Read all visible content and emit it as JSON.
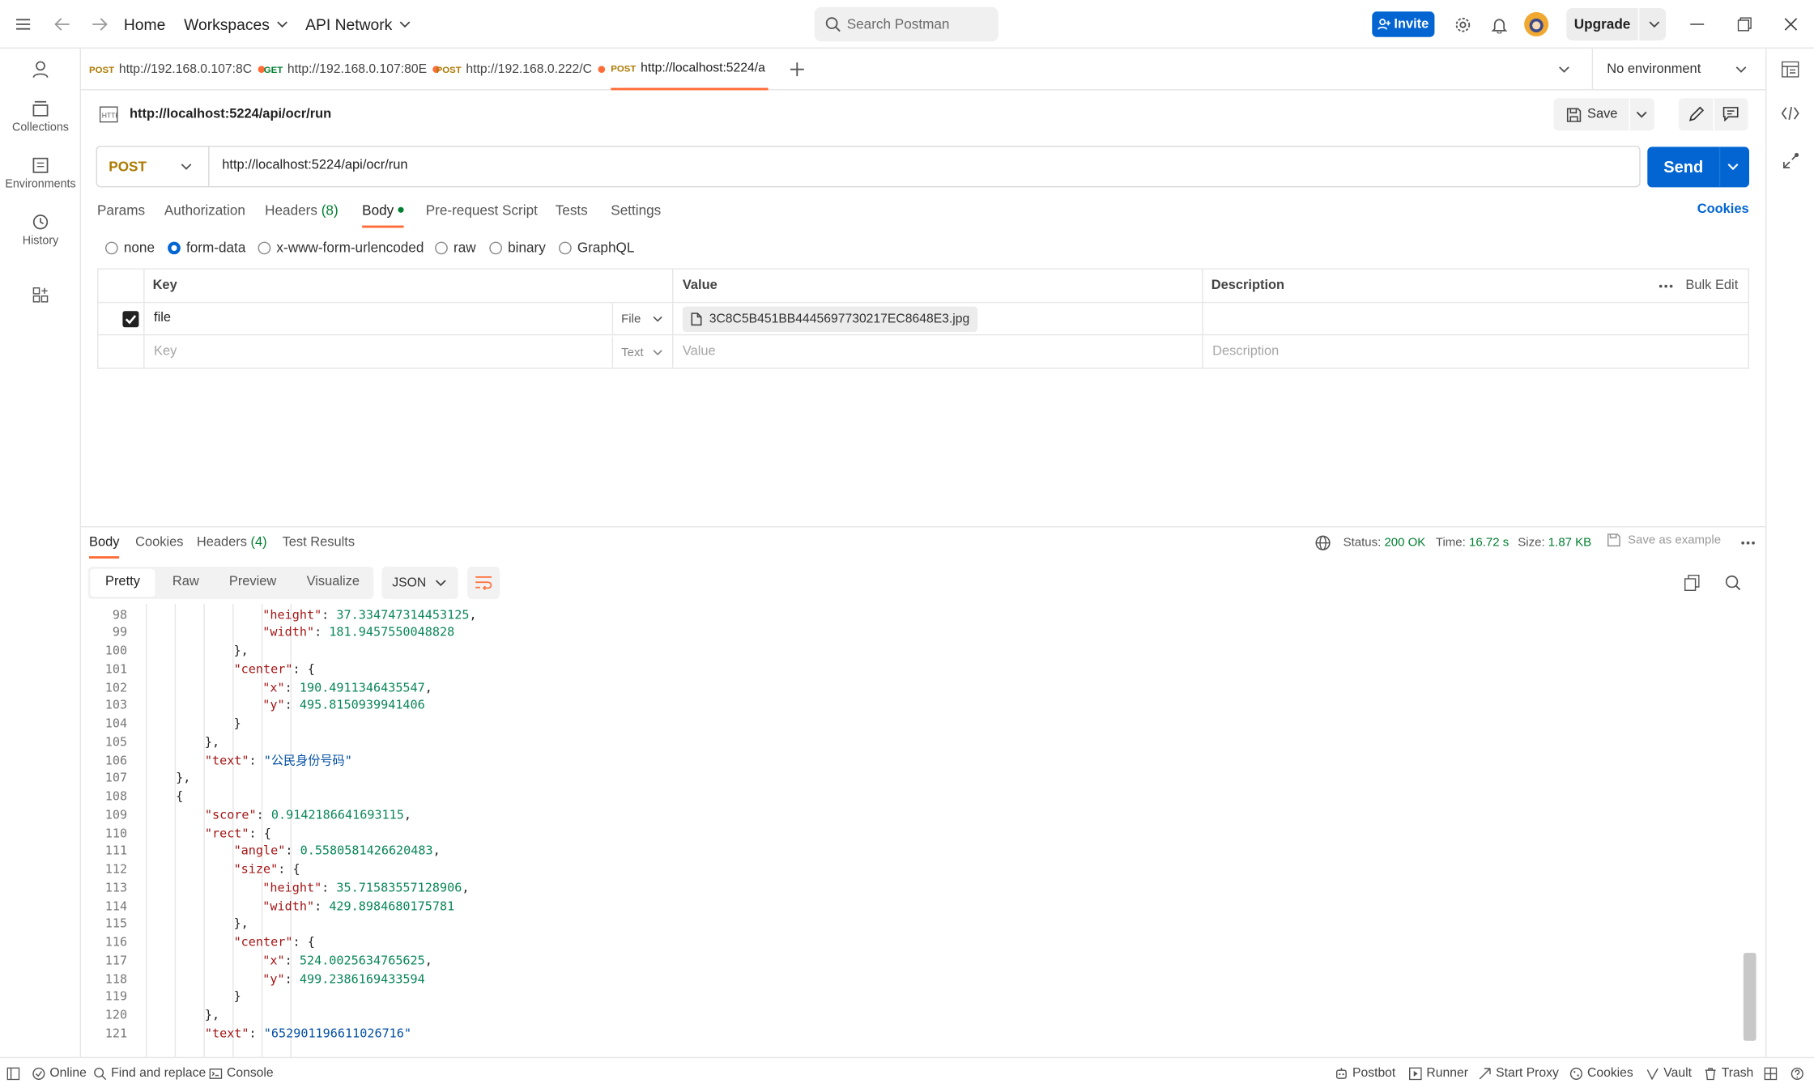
{
  "colors": {
    "accent": "#0265d2",
    "post": "#ad7a03",
    "get": "#007f31",
    "status_ok": "#007f31",
    "dot": "#ff6c37"
  },
  "titlebar": {
    "menu_icon": "hamburger-icon",
    "home": "Home",
    "workspaces": "Workspaces",
    "api_network": "API Network",
    "search_placeholder": "Search Postman",
    "invite": "Invite",
    "upgrade": "Upgrade"
  },
  "sidebar": {
    "items": [
      {
        "label": "Collections",
        "icon": "collections-icon"
      },
      {
        "label": "Environments",
        "icon": "environments-icon"
      },
      {
        "label": "History",
        "icon": "history-icon"
      }
    ]
  },
  "tabs": [
    {
      "method": "POST",
      "label": "http://192.168.0.107:8C"
    },
    {
      "method": "GET",
      "label": "http://192.168.0.107:80E"
    },
    {
      "method": "POST",
      "label": "http://192.168.0.222/C"
    },
    {
      "method": "POST",
      "label": "http://localhost:5224/a"
    }
  ],
  "environment": "No environment",
  "request": {
    "name": "http://localhost:5224/api/ocr/run",
    "save": "Save",
    "method": "POST",
    "url": "http://localhost:5224/api/ocr/run",
    "send": "Send",
    "tabs": [
      "Params",
      "Authorization",
      "Headers",
      "Body",
      "Pre-request Script",
      "Tests",
      "Settings"
    ],
    "headers_count": "(8)",
    "cookies": "Cookies",
    "body_types": [
      "none",
      "form-data",
      "x-www-form-urlencoded",
      "raw",
      "binary",
      "GraphQL"
    ],
    "selected_body_type": "form-data",
    "table": {
      "headers": [
        "Key",
        "Value",
        "Description"
      ],
      "bulk_edit": "Bulk Edit",
      "rows": [
        {
          "checked": true,
          "key": "file",
          "type": "File",
          "value": "3C8C5B451BB4445697730217EC8648E3.jpg",
          "description": ""
        }
      ],
      "placeholder": {
        "key": "Key",
        "type": "Text",
        "value": "Value",
        "description": "Description"
      }
    }
  },
  "response": {
    "tabs": [
      "Body",
      "Cookies",
      "Headers",
      "Test Results"
    ],
    "headers_count": "(4)",
    "status_label": "Status:",
    "status": "200 OK",
    "time_label": "Time:",
    "time": "16.72 s",
    "size_label": "Size:",
    "size": "1.87 KB",
    "save_example": "Save as example",
    "formats": [
      "Pretty",
      "Raw",
      "Preview",
      "Visualize"
    ],
    "language": "JSON",
    "lines": [
      {
        "no": "98",
        "indent": 7,
        "key": "\"height\"",
        "val": "37.334747314453125",
        "vt": "n",
        "tail": ","
      },
      {
        "no": "99",
        "indent": 7,
        "key": "\"width\"",
        "val": "181.9457550048828",
        "vt": "n",
        "tail": ""
      },
      {
        "no": "100",
        "indent": 6,
        "key": "",
        "val": "",
        "vt": "",
        "tail": "},"
      },
      {
        "no": "101",
        "indent": 6,
        "key": "\"center\"",
        "val": "",
        "vt": "",
        "tail": "{"
      },
      {
        "no": "102",
        "indent": 7,
        "key": "\"x\"",
        "val": "190.4911346435547",
        "vt": "n",
        "tail": ","
      },
      {
        "no": "103",
        "indent": 7,
        "key": "\"y\"",
        "val": "495.8150939941406",
        "vt": "n",
        "tail": ""
      },
      {
        "no": "104",
        "indent": 6,
        "key": "",
        "val": "",
        "vt": "",
        "tail": "}"
      },
      {
        "no": "105",
        "indent": 5,
        "key": "",
        "val": "",
        "vt": "",
        "tail": "},"
      },
      {
        "no": "106",
        "indent": 5,
        "key": "\"text\"",
        "val": "\"公民身份号码\"",
        "vt": "s",
        "tail": ""
      },
      {
        "no": "107",
        "indent": 4,
        "key": "",
        "val": "",
        "vt": "",
        "tail": "},"
      },
      {
        "no": "108",
        "indent": 4,
        "key": "",
        "val": "",
        "vt": "",
        "tail": "{"
      },
      {
        "no": "109",
        "indent": 5,
        "key": "\"score\"",
        "val": "0.9142186641693115",
        "vt": "n",
        "tail": ","
      },
      {
        "no": "110",
        "indent": 5,
        "key": "\"rect\"",
        "val": "",
        "vt": "",
        "tail": "{"
      },
      {
        "no": "111",
        "indent": 6,
        "key": "\"angle\"",
        "val": "0.5580581426620483",
        "vt": "n",
        "tail": ","
      },
      {
        "no": "112",
        "indent": 6,
        "key": "\"size\"",
        "val": "",
        "vt": "",
        "tail": "{"
      },
      {
        "no": "113",
        "indent": 7,
        "key": "\"height\"",
        "val": "35.71583557128906",
        "vt": "n",
        "tail": ","
      },
      {
        "no": "114",
        "indent": 7,
        "key": "\"width\"",
        "val": "429.8984680175781",
        "vt": "n",
        "tail": ""
      },
      {
        "no": "115",
        "indent": 6,
        "key": "",
        "val": "",
        "vt": "",
        "tail": "},"
      },
      {
        "no": "116",
        "indent": 6,
        "key": "\"center\"",
        "val": "",
        "vt": "",
        "tail": "{"
      },
      {
        "no": "117",
        "indent": 7,
        "key": "\"x\"",
        "val": "524.0025634765625",
        "vt": "n",
        "tail": ","
      },
      {
        "no": "118",
        "indent": 7,
        "key": "\"y\"",
        "val": "499.2386169433594",
        "vt": "n",
        "tail": ""
      },
      {
        "no": "119",
        "indent": 6,
        "key": "",
        "val": "",
        "vt": "",
        "tail": "}"
      },
      {
        "no": "120",
        "indent": 5,
        "key": "",
        "val": "",
        "vt": "",
        "tail": "},"
      },
      {
        "no": "121",
        "indent": 5,
        "key": "\"text\"",
        "val": "\"652901196611026716\"",
        "vt": "s",
        "tail": ""
      }
    ]
  },
  "statusbar": {
    "online": "Online",
    "find_replace": "Find and replace",
    "console": "Console",
    "postbot": "Postbot",
    "runner": "Runner",
    "start_proxy": "Start Proxy",
    "cookies": "Cookies",
    "vault": "Vault",
    "trash": "Trash"
  }
}
